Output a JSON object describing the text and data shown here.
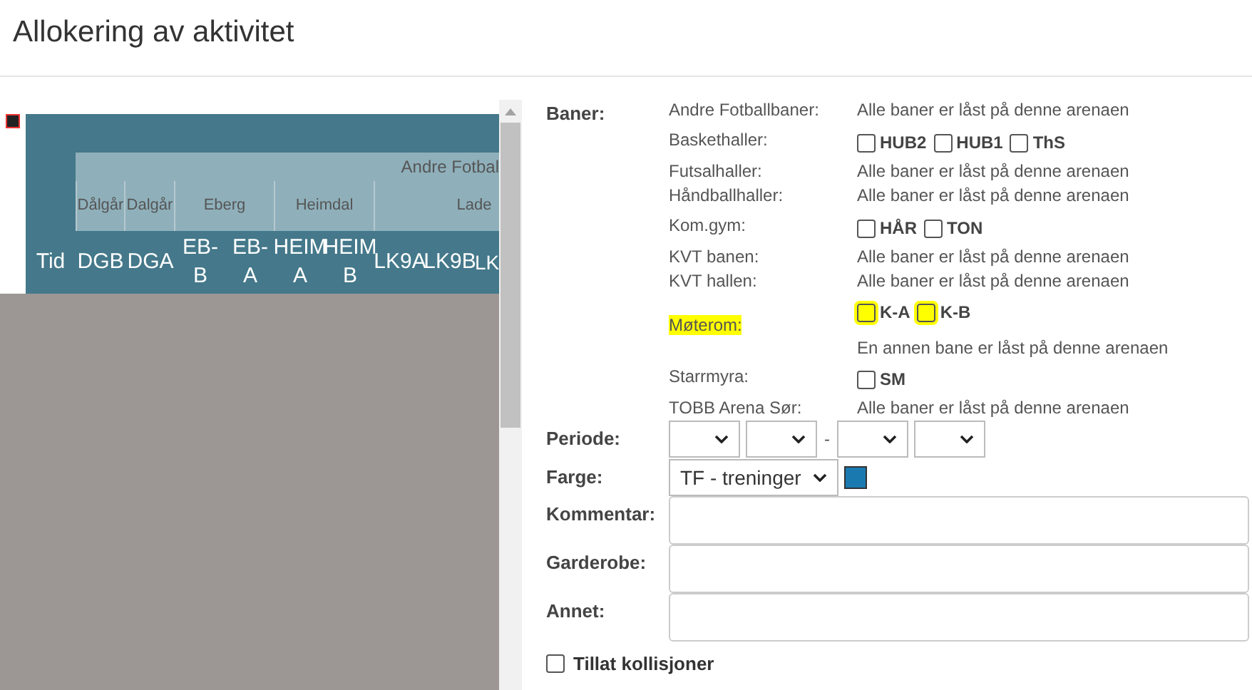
{
  "title": "Allokering av aktivitet",
  "table": {
    "group_header": "Andre Fotbal",
    "time_column": "Tid",
    "venues": [
      {
        "label": "Dålgår",
        "columns": [
          "DGB"
        ]
      },
      {
        "label": "Dalgår",
        "columns": [
          "DGA"
        ]
      },
      {
        "label": "Eberg",
        "columns": [
          "EB-B",
          "EB-A"
        ]
      },
      {
        "label": "Heimdal",
        "columns": [
          "HEIM A",
          "HEIM B"
        ]
      },
      {
        "label": "Lade",
        "columns": [
          "LK9A",
          "LK9B",
          "LK"
        ]
      }
    ]
  },
  "form": {
    "baner_label": "Baner:",
    "arenas": [
      {
        "name": "Andre Fotballbaner:",
        "kind": "locked",
        "text": "Alle baner er låst på denne arenaen",
        "highlighted": false
      },
      {
        "name": "Baskethaller:",
        "kind": "checkboxes",
        "highlighted": false,
        "options": [
          {
            "label": "HUB2",
            "checked": false
          },
          {
            "label": "HUB1",
            "checked": false
          },
          {
            "label": "ThS",
            "checked": false
          }
        ]
      },
      {
        "name": "Futsalhaller:",
        "kind": "locked",
        "text": "Alle baner er låst på denne arenaen",
        "highlighted": false
      },
      {
        "name": "Håndballhaller:",
        "kind": "locked",
        "text": "Alle baner er låst på denne arenaen",
        "highlighted": false
      },
      {
        "name": "Kom.gym:",
        "kind": "checkboxes",
        "highlighted": false,
        "options": [
          {
            "label": "HÅR",
            "checked": false
          },
          {
            "label": "TON",
            "checked": false
          }
        ]
      },
      {
        "name": "KVT banen:",
        "kind": "locked",
        "text": "Alle baner er låst på denne arenaen",
        "highlighted": false
      },
      {
        "name": "KVT hallen:",
        "kind": "locked",
        "text": "Alle baner er låst på denne arenaen",
        "highlighted": false
      },
      {
        "name": "Møterom:",
        "kind": "checkboxes",
        "highlighted": true,
        "note": "En annen bane er låst på denne arenaen",
        "options": [
          {
            "label": "K-A",
            "checked": false
          },
          {
            "label": "K-B",
            "checked": false
          }
        ]
      },
      {
        "name": "Starrmyra:",
        "kind": "checkboxes",
        "highlighted": false,
        "options": [
          {
            "label": "SM",
            "checked": false
          }
        ]
      },
      {
        "name": "TOBB Arena Sør:",
        "kind": "locked",
        "text": "Alle baner er låst på denne arenaen",
        "highlighted": false
      }
    ],
    "periode_label": "Periode:",
    "periode_separator": "-",
    "farge_label": "Farge:",
    "farge_value": "TF - treninger",
    "text_fields": [
      {
        "label": "Kommentar:"
      },
      {
        "label": "Garderobe:"
      },
      {
        "label": "Annet:"
      }
    ],
    "allow_collisions": {
      "label": "Tillat kollisjoner",
      "checked": false
    }
  }
}
